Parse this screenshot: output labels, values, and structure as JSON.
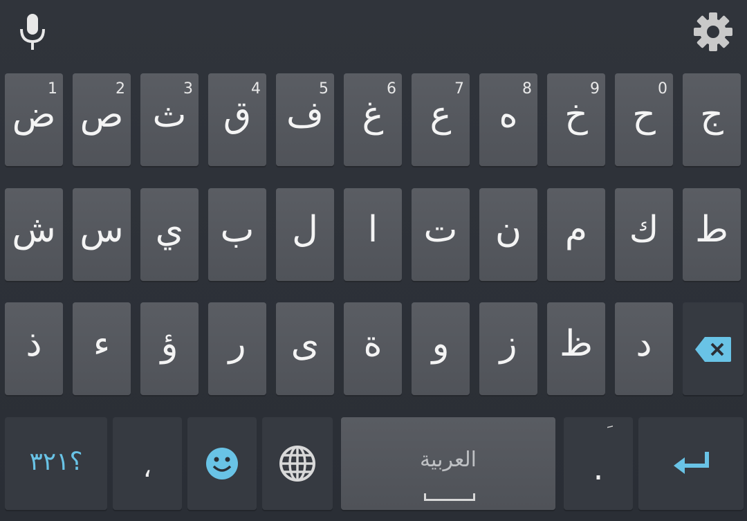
{
  "keyboard": {
    "language_label": "العربية",
    "symbols_label": "؟٣٢١",
    "comma_label": "،",
    "period_label": ".",
    "period_hint": "َ",
    "row1": [
      {
        "ch": "ض",
        "hint": "1"
      },
      {
        "ch": "ص",
        "hint": "2"
      },
      {
        "ch": "ث",
        "hint": "3"
      },
      {
        "ch": "ق",
        "hint": "4"
      },
      {
        "ch": "ف",
        "hint": "5"
      },
      {
        "ch": "غ",
        "hint": "6"
      },
      {
        "ch": "ع",
        "hint": "7"
      },
      {
        "ch": "ه",
        "hint": "8"
      },
      {
        "ch": "خ",
        "hint": "9"
      },
      {
        "ch": "ح",
        "hint": "0"
      },
      {
        "ch": "ج",
        "hint": ""
      }
    ],
    "row2": [
      "ش",
      "س",
      "ي",
      "ب",
      "ل",
      "ا",
      "ت",
      "ن",
      "م",
      "ك",
      "ط"
    ],
    "row3": [
      "ذ",
      "ء",
      "ؤ",
      "ر",
      "ى",
      "ة",
      "و",
      "ز",
      "ظ",
      "د"
    ],
    "colors": {
      "accent": "#69c3e6",
      "key": "#55585e",
      "background": "#2b2f36"
    },
    "icons": [
      "microphone-icon",
      "gear-icon",
      "backspace-icon",
      "emoji-icon",
      "globe-icon",
      "enter-icon"
    ]
  }
}
